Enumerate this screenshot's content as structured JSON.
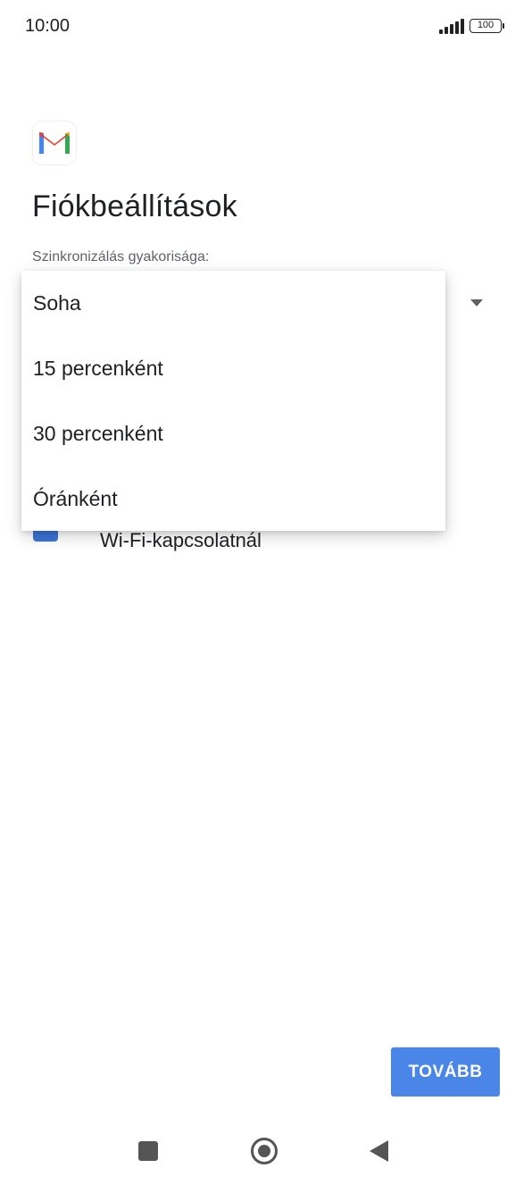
{
  "status_bar": {
    "time": "10:00",
    "battery": "100",
    "signal_icon": "cellular-signal-icon",
    "battery_icon": "battery-icon"
  },
  "app": {
    "logo_icon": "gmail-logo-icon",
    "title": "Fiókbeállítások",
    "sync_label": "Szinkronizálás gyakorisága:"
  },
  "sync_dropdown": {
    "options": [
      "Soha",
      "15 percenként",
      "30 percenként",
      "Óránként"
    ]
  },
  "wifi_option": {
    "label": "Wi-Fi-kapcsolatnál"
  },
  "actions": {
    "continue_label": "TOVÁBB"
  },
  "colors": {
    "accent": "#4a86e8",
    "gmail_red": "#ea4335",
    "gmail_blue": "#4285f4",
    "gmail_green": "#34a853",
    "gmail_yellow": "#fbbc04"
  },
  "nav_bar": {
    "recents_icon": "square-recents-icon",
    "home_icon": "circle-home-icon",
    "back_icon": "triangle-back-icon"
  }
}
